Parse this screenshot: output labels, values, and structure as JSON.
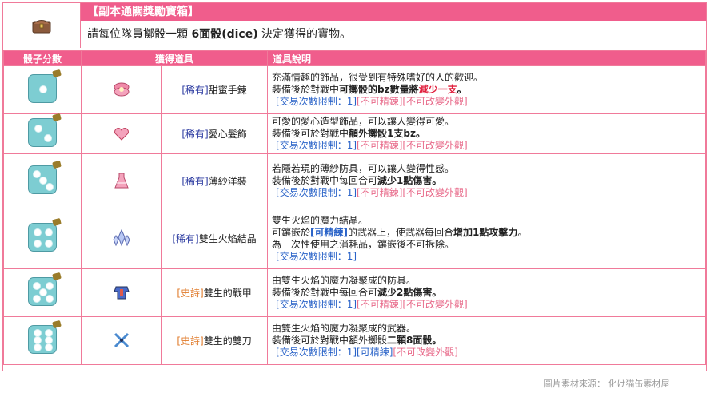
{
  "header": {
    "icon": "treasure-chest-icon",
    "title": "【副本通關獎勵寶箱】",
    "subtitle_pre": "請每位隊員擲骰一顆 ",
    "subtitle_bold": "6面骰(dice)",
    "subtitle_post": " 決定獲得的寶物。"
  },
  "columns": [
    "骰子分數",
    "獲得道具",
    "道具說明"
  ],
  "rows": [
    {
      "dice": 1,
      "item_icon": "candy-bracelet-icon",
      "tag": "[稀有]",
      "tag_type": "rare",
      "name": "甜蜜手鍊",
      "d1": "充滿情趣的飾品，很受到有特殊嗜好的人的歡迎。",
      "d2a": "裝備後於對戰中",
      "d2b": "可擲骰的bz數量將",
      "d2c": "減少一支",
      "d2d": "。",
      "d3a": "[交易次數限制：1]",
      "d3b": "[不可精鍊][不可改變外觀]"
    },
    {
      "dice": 2,
      "item_icon": "heart-hairpin-icon",
      "tag": "[稀有]",
      "tag_type": "rare",
      "name": "愛心髮飾",
      "d1": "可愛的愛心造型飾品，可以讓人變得可愛。",
      "d2a": "裝備後可於對戰中",
      "d2b": "額外擲骰1支bz",
      "d2c": "",
      "d2d": "。",
      "d3a": "[交易次數限制：1]",
      "d3b": "[不可精鍊][不可改變外觀]"
    },
    {
      "dice": 3,
      "item_icon": "pink-dress-icon",
      "tag": "[稀有]",
      "tag_type": "rare",
      "name": "薄紗洋裝",
      "d1": "若隱若現的薄紗防具，可以讓人變得性感。",
      "d2a": "裝備後於對戰中每回合可",
      "d2b": "減少1點傷害",
      "d2c": "",
      "d2d": "。",
      "d3a": "[交易次數限制：1]",
      "d3b": "[不可精鍊][不可改變外觀]"
    },
    {
      "dice": 4,
      "item_icon": "crystal-cluster-icon",
      "tag": "[稀有]",
      "tag_type": "rare",
      "name": "雙生火焰結晶",
      "d1": "雙生火焰的魔力結晶。",
      "d2a": "可鑲嵌於",
      "d2b": "[可精練]",
      "d2c": "的武器上，使武器每回合",
      "d2d": "增加1點攻擊力",
      "d2e": "。",
      "d2f": "為一次性使用之消耗品，鑲嵌後不可拆除。",
      "d3a": "[交易次數限制：1]",
      "d3b": ""
    },
    {
      "dice": 5,
      "item_icon": "armor-icon",
      "tag": "[史詩]",
      "tag_type": "epic",
      "name": "雙生的戰甲",
      "d1": "由雙生火焰的魔力凝聚成的防具。",
      "d2a": "裝備後於對戰中每回合可",
      "d2b": "減少2點傷害",
      "d2c": "",
      "d2d": "。",
      "d3a": "[交易次數限制：1]",
      "d3b": "[不可精鍊][不可改變外觀]"
    },
    {
      "dice": 6,
      "item_icon": "twin-swords-icon",
      "tag": "[史詩]",
      "tag_type": "epic",
      "name": "雙生的雙刀",
      "d1": "由雙生火焰的魔力凝聚成的武器。",
      "d2a": "裝備後可於對戰中額外擲骰",
      "d2b": "二顆8面骰",
      "d2c": "",
      "d2d": "。",
      "d3a": "[交易次數限制：1]",
      "d3b": "[可精練]",
      "d3c": "[不可改變外觀]"
    }
  ],
  "credit": "圖片素材來源： 化け猫缶素材屋",
  "colors": {
    "accent": "#f05d8c",
    "border": "#f07a9a",
    "dice": "#7dcdd2",
    "rare": "#2b3aa0",
    "epic": "#e07a2a",
    "limit": "#2a63c8",
    "restrict": "#e86a8a"
  }
}
